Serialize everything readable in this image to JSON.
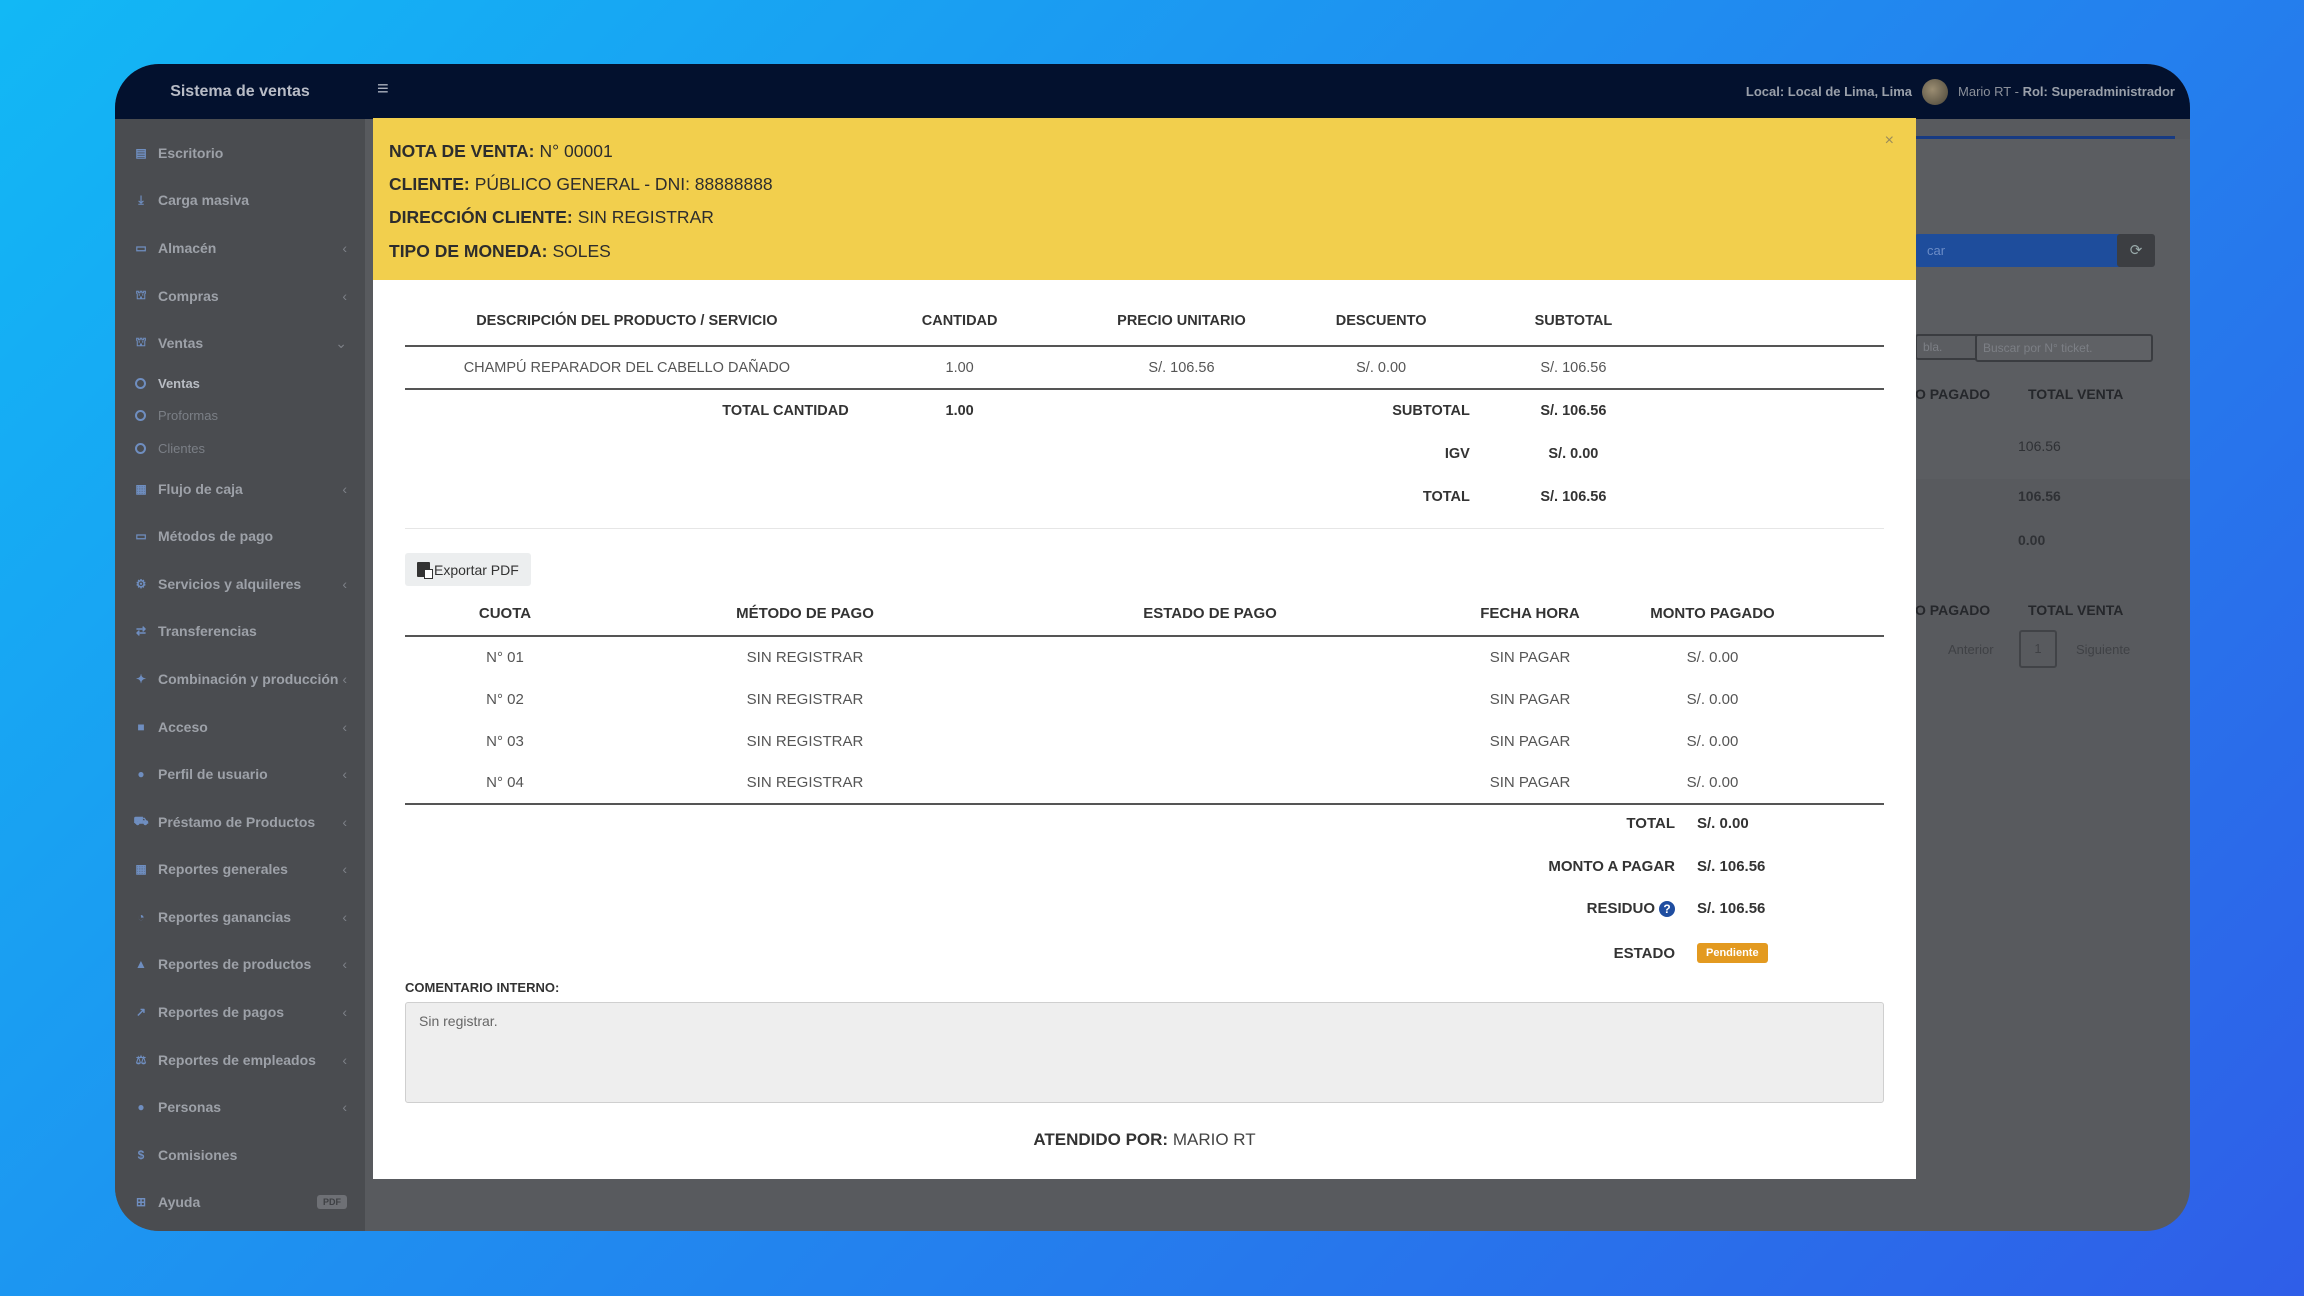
{
  "app": {
    "title": "Sistema de ventas"
  },
  "topbar": {
    "local_label": "Local: Local de Lima, Lima",
    "user_name": "Mario RT",
    "role_label": "Rol: Superadministrador"
  },
  "sidebar": {
    "items": [
      {
        "label": "Escritorio",
        "icon": "dashboard-icon"
      },
      {
        "label": "Carga masiva",
        "icon": "download-icon"
      },
      {
        "label": "Almacén",
        "icon": "laptop-icon"
      },
      {
        "label": "Compras",
        "icon": "cart-icon"
      },
      {
        "label": "Ventas",
        "icon": "cart-icon"
      }
    ],
    "sub_items": [
      "Ventas",
      "Proformas",
      "Clientes"
    ],
    "items_after": [
      {
        "label": "Flujo de caja",
        "icon": "calendar-icon"
      },
      {
        "label": "Métodos de pago",
        "icon": "credit-card-icon"
      },
      {
        "label": "Servicios y alquileres",
        "icon": "gears-icon"
      },
      {
        "label": "Transferencias",
        "icon": "exchange-icon"
      },
      {
        "label": "Combinación y producción",
        "icon": "wand-icon"
      },
      {
        "label": "Acceso",
        "icon": "folder-icon"
      },
      {
        "label": "Perfil de usuario",
        "icon": "user-icon"
      },
      {
        "label": "Préstamo de Productos",
        "icon": "truck-icon"
      },
      {
        "label": "Reportes generales",
        "icon": "bar-chart-icon"
      },
      {
        "label": "Reportes ganancias",
        "icon": "pie-chart-icon"
      },
      {
        "label": "Reportes de productos",
        "icon": "area-chart-icon"
      },
      {
        "label": "Reportes de pagos",
        "icon": "line-chart-icon"
      },
      {
        "label": "Reportes de empleados",
        "icon": "balance-icon"
      },
      {
        "label": "Personas",
        "icon": "users-icon"
      },
      {
        "label": "Comisiones",
        "icon": "dollar-icon"
      },
      {
        "label": "Ayuda",
        "icon": "plus-square-icon",
        "badge": "PDF"
      }
    ]
  },
  "background": {
    "search_button": "car",
    "input_partial": "bla.",
    "ticket_placeholder": "Buscar por N° ticket.",
    "col_paid": "O PAGADO",
    "col_total": "TOTAL VENTA",
    "row1_total": "106.56",
    "row2_total": "106.56",
    "row3_total": "0.00",
    "prev_label": "Anterior",
    "page_num": "1",
    "next_label": "Siguiente"
  },
  "modal": {
    "header": {
      "nota_label": "NOTA DE VENTA:",
      "nota_value": "N° 00001",
      "cliente_label": "CLIENTE:",
      "cliente_value": "PÚBLICO GENERAL - DNI: 88888888",
      "direccion_label": "DIRECCIÓN CLIENTE:",
      "direccion_value": "SIN REGISTRAR",
      "moneda_label": "TIPO DE MONEDA:",
      "moneda_value": "SOLES"
    },
    "products": {
      "headers": [
        "DESCRIPCIÓN DEL PRODUCTO / SERVICIO",
        "CANTIDAD",
        "PRECIO UNITARIO",
        "DESCUENTO",
        "SUBTOTAL"
      ],
      "rows": [
        [
          "CHAMPÚ REPARADOR DEL CABELLO DAÑADO",
          "1.00",
          "S/. 106.56",
          "S/. 0.00",
          "S/. 106.56"
        ]
      ],
      "total_cantidad_label": "TOTAL CANTIDAD",
      "total_cantidad_value": "1.00",
      "subtotal_label": "SUBTOTAL",
      "subtotal_value": "S/. 106.56",
      "igv_label": "IGV",
      "igv_value": "S/. 0.00",
      "total_label": "TOTAL",
      "total_value": "S/. 106.56"
    },
    "export_label": "Exportar PDF",
    "payments": {
      "headers": [
        "CUOTA",
        "MÉTODO DE PAGO",
        "ESTADO DE PAGO",
        "FECHA HORA",
        "MONTO PAGADO"
      ],
      "rows": [
        [
          "N° 01",
          "SIN REGISTRAR",
          "",
          "SIN PAGAR",
          "S/. 0.00"
        ],
        [
          "N° 02",
          "SIN REGISTRAR",
          "",
          "SIN PAGAR",
          "S/. 0.00"
        ],
        [
          "N° 03",
          "SIN REGISTRAR",
          "",
          "SIN PAGAR",
          "S/. 0.00"
        ],
        [
          "N° 04",
          "SIN REGISTRAR",
          "",
          "SIN PAGAR",
          "S/. 0.00"
        ]
      ],
      "total_label": "TOTAL",
      "total_value": "S/. 0.00",
      "monto_label": "MONTO A PAGAR",
      "monto_value": "S/. 106.56",
      "residuo_label": "RESIDUO",
      "residuo_value": "S/. 106.56",
      "estado_label": "ESTADO",
      "estado_value": "Pendiente"
    },
    "comment_label": "COMENTARIO INTERNO:",
    "comment_value": "Sin registrar.",
    "attended_label": "ATENDIDO POR:",
    "attended_value": "MARIO RT"
  },
  "colors": {
    "header_yellow": "#f2cf4d",
    "topbar": "#03112e",
    "status_pending": "#e39a20"
  }
}
